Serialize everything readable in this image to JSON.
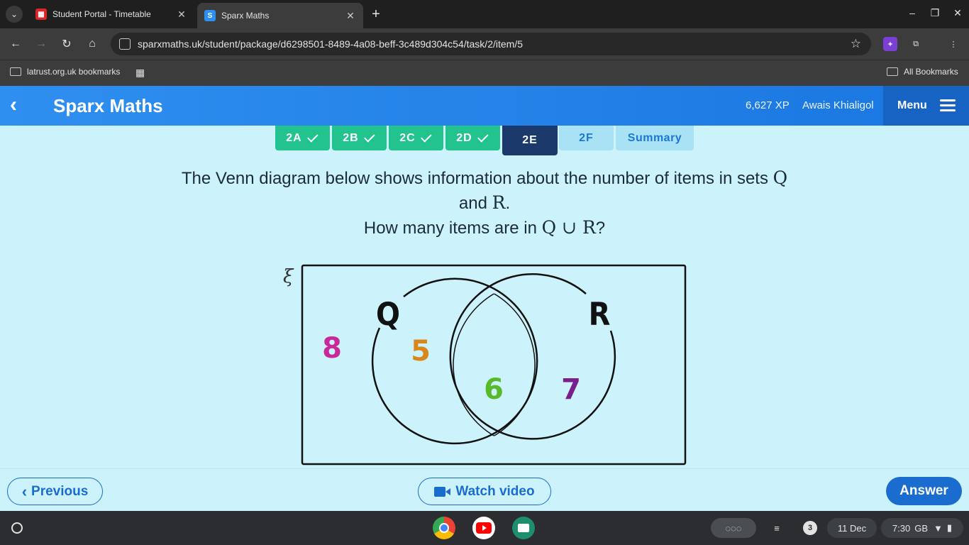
{
  "browser": {
    "tabs": [
      {
        "title": "Student Portal - Timetable"
      },
      {
        "title": "Sparx Maths",
        "favicon": "S"
      }
    ],
    "url": "sparxmaths.uk/student/package/d6298501-8489-4a08-beff-3c489d304c54/task/2/item/5",
    "bookmarks": {
      "left": "latrust.org.uk bookmarks",
      "right": "All Bookmarks"
    }
  },
  "header": {
    "brand": "Sparx Maths",
    "xp": "6,627 XP",
    "user": "Awais Khialigol",
    "menu": "Menu"
  },
  "task_tabs": [
    {
      "label": "2A",
      "status": "done"
    },
    {
      "label": "2B",
      "status": "done"
    },
    {
      "label": "2C",
      "status": "done"
    },
    {
      "label": "2D",
      "status": "done"
    },
    {
      "label": "2E",
      "status": "active"
    },
    {
      "label": "2F",
      "status": "todo"
    },
    {
      "label": "Summary",
      "status": "todo"
    }
  ],
  "question": {
    "line1_text": "The Venn diagram below shows information about the number of items in sets ",
    "line1_math": "Q",
    "line2_text": "and ",
    "line2_math": "R",
    "line2_end": ".",
    "line3_text": "How many items are in ",
    "line3_math": "Q ∪ R",
    "line3_end": "?"
  },
  "venn": {
    "universal_symbol": "ξ",
    "set_labels": {
      "left": "Q",
      "right": "R"
    },
    "values": {
      "outside": "8",
      "q_only": "5",
      "intersection": "6",
      "r_only": "7"
    },
    "colors": {
      "outside": "#c8289a",
      "q_only": "#d9861c",
      "intersection": "#5ab82c",
      "r_only": "#7a1e8e"
    }
  },
  "footer": {
    "previous": "Previous",
    "watch_video": "Watch video",
    "answer": "Answer"
  },
  "shelf": {
    "notifications": "3",
    "date": "11 Dec",
    "time": "7:30",
    "network": "GB"
  },
  "colors": {
    "accent": "#1a6ccf",
    "done": "#22c38e",
    "active": "#1b3a6b",
    "page_bg": "#ccf3fb"
  }
}
